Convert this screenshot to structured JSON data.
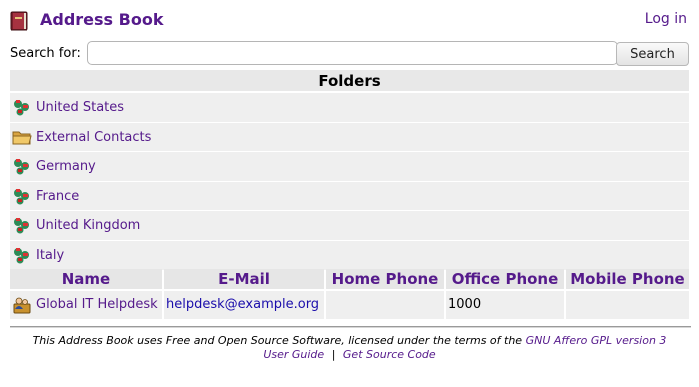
{
  "header": {
    "title": "Address Book",
    "login_label": "Log in",
    "icon": "address-book-icon"
  },
  "search": {
    "label": "Search for:",
    "value": "",
    "placeholder": "",
    "button_label": "Search"
  },
  "folders": {
    "heading": "Folders",
    "items": [
      {
        "label": "United States",
        "icon": "world-contacts-icon"
      },
      {
        "label": "External Contacts",
        "icon": "folder-icon"
      },
      {
        "label": "Germany",
        "icon": "world-contacts-icon"
      },
      {
        "label": "France",
        "icon": "world-contacts-icon"
      },
      {
        "label": "United Kingdom",
        "icon": "world-contacts-icon"
      },
      {
        "label": "Italy",
        "icon": "world-contacts-icon"
      }
    ]
  },
  "contacts": {
    "columns": [
      "Name",
      "E-Mail",
      "Home Phone",
      "Office Phone",
      "Mobile Phone"
    ],
    "rows": [
      {
        "name": "Global IT Helpdesk",
        "email": "helpdesk@example.org",
        "home_phone": "",
        "office_phone": "1000",
        "mobile_phone": "",
        "icon": "group-contact-icon"
      }
    ]
  },
  "footer": {
    "text": "This Address Book uses Free and Open Source Software, licensed under the terms of the",
    "license_link": "GNU Affero GPL version 3",
    "user_guide_link": "User Guide",
    "separator": "|",
    "source_link": "Get Source Code"
  },
  "colors": {
    "link": "#551a8b",
    "email_link": "#1a0dab",
    "row_background": "#efefef",
    "header_background": "#e8e8e8"
  }
}
